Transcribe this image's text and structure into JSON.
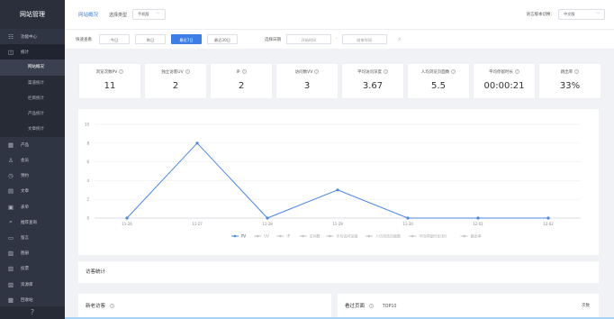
{
  "sidebar": {
    "title": "网站管理",
    "items": [
      {
        "label": "功能中心",
        "icon": "apps-icon"
      },
      {
        "label": "统计",
        "icon": "chart-icon"
      },
      {
        "label": "产品",
        "icon": "grid-icon"
      },
      {
        "label": "会员",
        "icon": "user-icon"
      },
      {
        "label": "预约",
        "icon": "clock-icon"
      },
      {
        "label": "文章",
        "icon": "document-icon"
      },
      {
        "label": "表单",
        "icon": "form-icon"
      },
      {
        "label": "推荐查询",
        "icon": "search-icon"
      },
      {
        "label": "留言",
        "icon": "message-icon"
      },
      {
        "label": "图册",
        "icon": "image-icon"
      },
      {
        "label": "投票",
        "icon": "vote-icon"
      },
      {
        "label": "资源库",
        "icon": "database-icon"
      },
      {
        "label": "回收站",
        "icon": "trash-icon"
      }
    ],
    "sub_items": [
      "网站概况",
      "渠道统计",
      "栏目统计",
      "产品统计",
      "文章统计"
    ],
    "help_icon": "?"
  },
  "topbar": {
    "title": "网站概况",
    "type_label": "选择类型",
    "type_value": "手机版",
    "lang_label": "语言版本切换：",
    "lang_value": "中文版"
  },
  "filter": {
    "quick_label": "快速查看",
    "buttons": [
      "今日",
      "昨日",
      "最近7日",
      "最近30日"
    ],
    "date_label": "选择日期",
    "start_placeholder": "开始时间",
    "end_placeholder": "结束时间",
    "dash": "-",
    "clear": "×"
  },
  "stats": [
    {
      "name": "浏览次数PV",
      "value": "11"
    },
    {
      "name": "独立访客UV",
      "value": "2"
    },
    {
      "name": "IP",
      "value": "2"
    },
    {
      "name": "访问数VV",
      "value": "3"
    },
    {
      "name": "平均访问深度",
      "value": "3.67"
    },
    {
      "name": "人均浏览页面数",
      "value": "5.5"
    },
    {
      "name": "平均停留时长",
      "value": "00:00:21"
    },
    {
      "name": "跳出率",
      "value": "33%"
    }
  ],
  "chart_data": {
    "type": "line",
    "categories": [
      "11-26",
      "11-27",
      "11-28",
      "11-29",
      "11-30",
      "12-01",
      "12-02"
    ],
    "series": [
      {
        "name": "PV",
        "values": [
          0,
          8,
          0,
          3,
          0,
          0,
          0
        ]
      }
    ],
    "legend": [
      "PV",
      "UV",
      "IP",
      "访问数",
      "平均访问深度",
      "人均浏览页面数",
      "平均停留时长(秒)",
      "跳出率"
    ],
    "yticks": [
      0,
      2,
      4,
      6,
      8,
      10
    ],
    "ylim": [
      0,
      10
    ],
    "grid": true,
    "legend_position": "bottom",
    "color": "#4a86e8"
  },
  "visitor": {
    "title": "访客统计"
  },
  "new_visitor": {
    "title": "新老访客"
  },
  "pages": {
    "title": "看过页面",
    "subtitle": "TOP10",
    "count_label": "次数"
  }
}
